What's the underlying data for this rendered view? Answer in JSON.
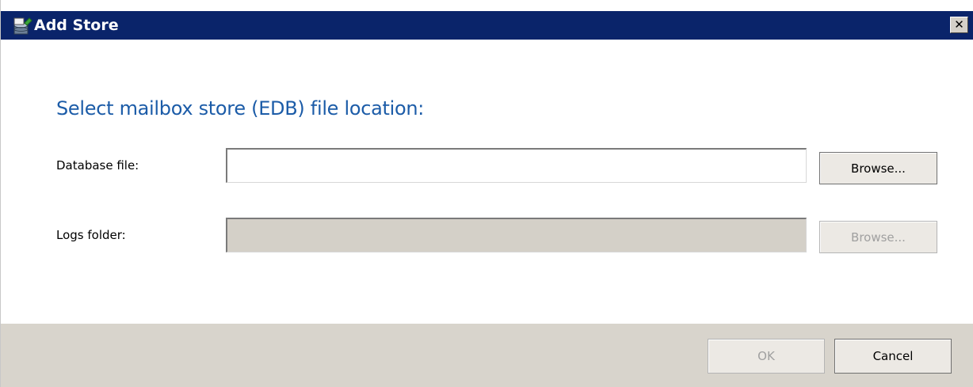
{
  "window": {
    "title": "Add Store",
    "icon": "mailbox-store-icon",
    "close_glyph": "✕"
  },
  "main": {
    "heading": "Select mailbox store (EDB) file location:",
    "database_file": {
      "label": "Database file:",
      "value": "",
      "browse_label": "Browse..."
    },
    "logs_folder": {
      "label": "Logs folder:",
      "value": "",
      "browse_label": "Browse..."
    }
  },
  "footer": {
    "ok_label": "OK",
    "cancel_label": "Cancel"
  },
  "colors": {
    "titlebar": "#0a246a",
    "heading": "#1c5ca8",
    "footer": "#d8d4cc",
    "disabled_field": "#d4d0c8"
  }
}
